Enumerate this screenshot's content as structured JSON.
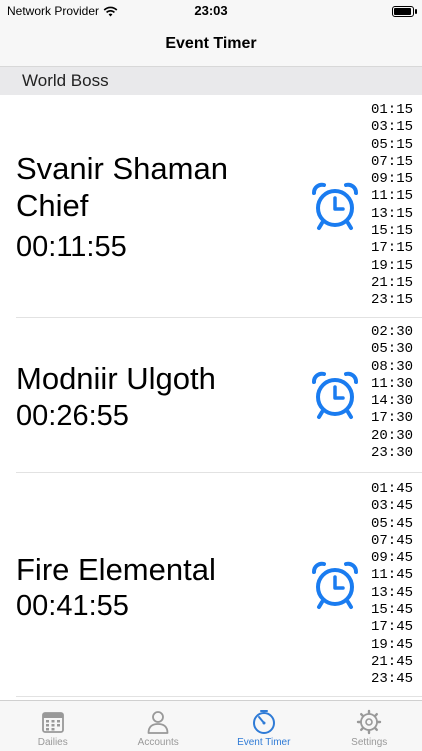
{
  "status_bar": {
    "carrier": "Network Provider",
    "time": "23:03"
  },
  "nav": {
    "title": "Event Timer"
  },
  "section": {
    "title": "World Boss"
  },
  "bosses": [
    {
      "name": "Svanir Shaman Chief",
      "countdown": "00:11:55",
      "times": [
        "01:15",
        "03:15",
        "05:15",
        "07:15",
        "09:15",
        "11:15",
        "13:15",
        "15:15",
        "17:15",
        "19:15",
        "21:15",
        "23:15"
      ]
    },
    {
      "name": "Modniir Ulgoth",
      "countdown": "00:26:55",
      "times": [
        "02:30",
        "05:30",
        "08:30",
        "11:30",
        "14:30",
        "17:30",
        "20:30",
        "23:30"
      ]
    },
    {
      "name": "Fire Elemental",
      "countdown": "00:41:55",
      "times": [
        "01:45",
        "03:45",
        "05:45",
        "07:45",
        "09:45",
        "11:45",
        "13:45",
        "15:45",
        "17:45",
        "19:45",
        "21:45",
        "23:45"
      ]
    }
  ],
  "tabs": [
    {
      "label": "Dailies",
      "icon": "calendar-icon",
      "active": false
    },
    {
      "label": "Accounts",
      "icon": "person-icon",
      "active": false
    },
    {
      "label": "Event Timer",
      "icon": "stopwatch-icon",
      "active": true
    },
    {
      "label": "Settings",
      "icon": "gear-icon",
      "active": false
    }
  ],
  "colors": {
    "accent": "#2f7bd6",
    "tab_inactive": "#999999",
    "alarm": "#1a7cf0"
  }
}
